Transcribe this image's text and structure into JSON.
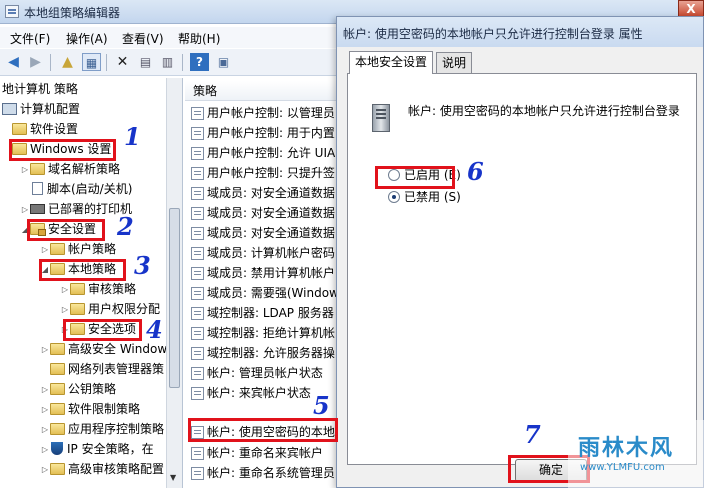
{
  "main_window": {
    "title": "本地组策略编辑器",
    "close_glyph": "X",
    "menu": [
      "文件(F)",
      "操作(A)",
      "查看(V)",
      "帮助(H)"
    ]
  },
  "tree": {
    "root": "地计算机 策略",
    "computer_config": "计算机配置",
    "software_settings": "软件设置",
    "windows_settings": "Windows 设置",
    "dns_policy": "域名解析策略",
    "scripts": "脚本(启动/关机)",
    "printers": "已部署的打印机",
    "security_settings": "安全设置",
    "account_policies": "帐户策略",
    "local_policies": "本地策略",
    "audit_policy": "审核策略",
    "user_rights": "用户权限分配",
    "security_options": "安全选项",
    "advanced_firewall": "高级安全 Window",
    "network_list": "网络列表管理器策",
    "public_key": "公钥策略",
    "software_restriction": "软件限制策略",
    "app_control": "应用程序控制策略",
    "ipsec": "IP 安全策略，在",
    "advanced_audit": "高级审核策略配置"
  },
  "policy_list": {
    "header": "策略",
    "rows": [
      "用户帐户控制: 以管理员",
      "用户帐户控制: 用于内置",
      "用户帐户控制: 允许 UIA",
      "用户帐户控制: 只提升签",
      "域成员: 对安全通道数据",
      "域成员: 对安全通道数据",
      "域成员: 对安全通道数据",
      "域成员: 计算机帐户密码",
      "域成员: 禁用计算机帐户",
      "域成员: 需要强(Window",
      "域控制器: LDAP 服务器",
      "域控制器: 拒绝计算机帐",
      "域控制器: 允许服务器操",
      "帐户: 管理员帐户状态",
      "帐户: 来宾帐户状态",
      "帐户: 使用空密码的本地",
      "帐户: 重命名来宾帐户",
      "帐户: 重命名系统管理员"
    ]
  },
  "dialog": {
    "title": "帐户: 使用空密码的本地帐户只允许进行控制台登录 属性",
    "tabs": [
      "本地安全设置",
      "说明"
    ],
    "policy_name": "帐户: 使用空密码的本地帐户只允许进行控制台登录",
    "option_enabled": "已启用 (E)",
    "option_disabled": "已禁用 (S)",
    "ok_label": "确定"
  },
  "annotations": [
    "1",
    "2",
    "3",
    "4",
    "5",
    "6",
    "7"
  ],
  "watermark": {
    "text": "雨林木风",
    "url": "www.YLMFU.com"
  },
  "colors": {
    "highlight": "#e1121b",
    "annotation_number": "#1734c9"
  }
}
